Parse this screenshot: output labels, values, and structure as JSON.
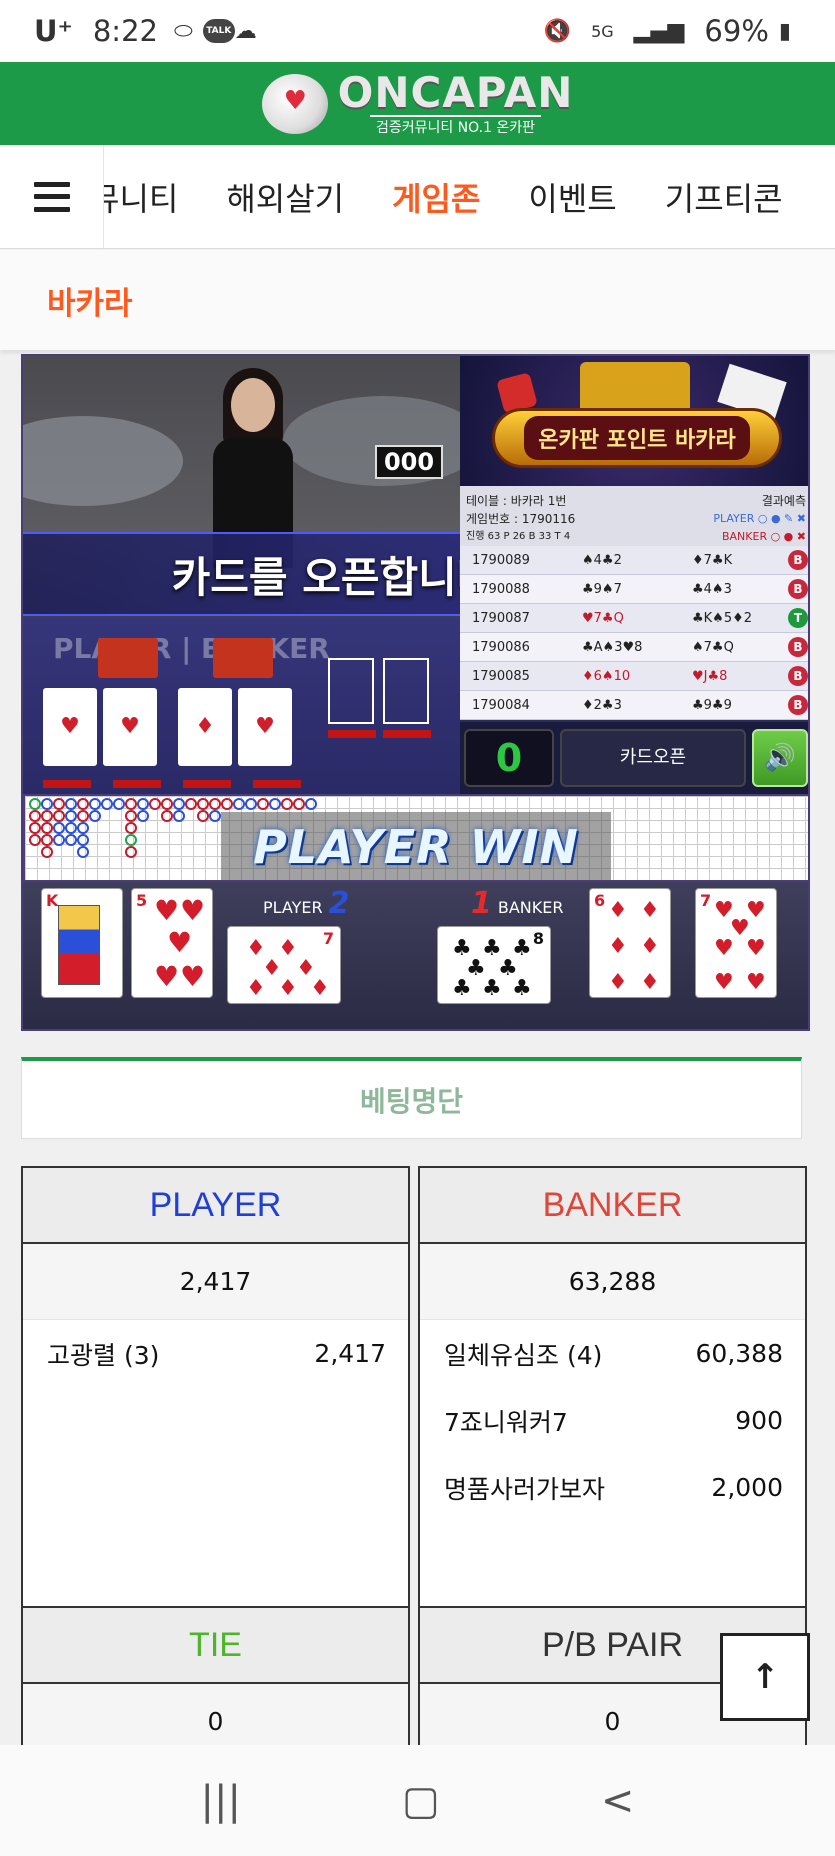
{
  "status_bar": {
    "carrier": "U⁺",
    "time": "8:22",
    "bubble": "TALK",
    "network": "5G",
    "battery": "69%"
  },
  "header": {
    "logo_main": "ONCAPAN",
    "logo_sub": "검증커뮤니티 NO.1 온카판"
  },
  "nav": {
    "items": [
      {
        "label": "뮤니티",
        "active": false
      },
      {
        "label": "해외살기",
        "active": false
      },
      {
        "label": "게임존",
        "active": true
      },
      {
        "label": "이벤트",
        "active": false
      },
      {
        "label": "기프티콘",
        "active": false
      }
    ]
  },
  "page": {
    "subtitle": "바카라"
  },
  "game": {
    "counter": "000",
    "open_message": "카드를 오픈합니다.",
    "pb_label": "PLAYER | BANKER",
    "promo_title": "온카판 포인트 바카라",
    "table_label": "테이블 : 바카라 1번",
    "result_forecast": "결과예측",
    "game_number": "게임번호 : 1790116",
    "player_small": "PLAYER",
    "progress_line": "진행 63  P 26  B 33  T 4",
    "banker_small": "BANKER",
    "results": [
      {
        "id": "1790089",
        "player": "♠4♣2",
        "banker": "♦7♣K",
        "winner": "B"
      },
      {
        "id": "1790088",
        "player": "♣9♠7",
        "banker": "♣4♠3",
        "winner": "B"
      },
      {
        "id": "1790087",
        "player": "♥7♣Q",
        "banker": "♣K♠5♦2",
        "winner": "T"
      },
      {
        "id": "1790086",
        "player": "♣A♠3♥8",
        "banker": "♠7♣Q",
        "winner": "B"
      },
      {
        "id": "1790085",
        "player": "♦6♠10",
        "banker": "♥J♣8",
        "winner": "B"
      },
      {
        "id": "1790084",
        "player": "♦2♣3",
        "banker": "♣9♣9",
        "winner": "B"
      }
    ],
    "score": "0",
    "open_button": "카드오픈",
    "sound_icon": "speaker-icon",
    "win_text": "PLAYER WIN",
    "player_label": "PLAYER",
    "player_score": "2",
    "banker_label": "BANKER",
    "banker_score": "1",
    "cards": {
      "player": [
        {
          "rank": "K",
          "suit": "♥",
          "color": "red"
        },
        {
          "rank": "5",
          "suit": "♥",
          "color": "red"
        },
        {
          "rank": "7",
          "suit": "♦",
          "color": "red"
        }
      ],
      "banker": [
        {
          "rank": "8",
          "suit": "♣",
          "color": "black"
        },
        {
          "rank": "6",
          "suit": "♦",
          "color": "red"
        },
        {
          "rank": "7",
          "suit": "♥",
          "color": "red"
        }
      ]
    }
  },
  "bet_list": {
    "title": "베팅명단",
    "columns": {
      "player": {
        "title": "PLAYER",
        "color": "#1e3fd8",
        "total": "2,417",
        "bettors": [
          {
            "name": "고광렬 (3)",
            "amount": "2,417"
          }
        ]
      },
      "banker": {
        "title": "BANKER",
        "color": "#e0453a",
        "total": "63,288",
        "bettors": [
          {
            "name": "일체유심조 (4)",
            "amount": "60,388"
          },
          {
            "name": "7죠니워커7",
            "amount": "900"
          },
          {
            "name": "명품사러가보자",
            "amount": "2,000"
          }
        ]
      },
      "tie": {
        "title": "TIE",
        "color": "#4cb52a",
        "total": "0"
      },
      "pair": {
        "title": "P/B PAIR",
        "color": "#333333",
        "total": "0"
      }
    }
  },
  "buttons": {
    "scroll_top": "↑"
  },
  "bottom_nav": {
    "recent": "|||",
    "home": "▢",
    "back": "<"
  }
}
